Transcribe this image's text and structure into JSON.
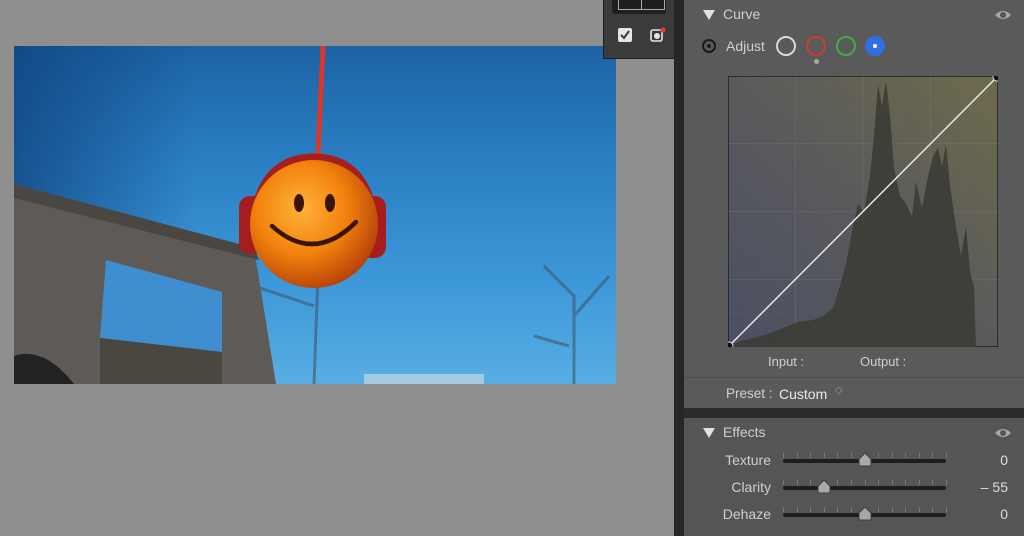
{
  "curve_panel": {
    "title": "Curve",
    "adjust_label": "Adjust",
    "channels": [
      {
        "name": "luminance",
        "color": "#d8d8d8",
        "selected": false
      },
      {
        "name": "red",
        "color": "#d03a34",
        "selected": false
      },
      {
        "name": "green",
        "color": "#3fae48",
        "selected": false
      },
      {
        "name": "blue",
        "color": "#2f6fe0",
        "selected": true
      }
    ],
    "input_label": "Input :",
    "output_label": "Output :",
    "preset_label": "Preset :",
    "preset_value": "Custom",
    "preset_chevron": "◇"
  },
  "effects_panel": {
    "title": "Effects",
    "sliders": [
      {
        "label": "Texture",
        "value": "0",
        "position": 0.5
      },
      {
        "label": "Clarity",
        "value": "– 55",
        "position": 0.25
      },
      {
        "label": "Dehaze",
        "value": "0",
        "position": 0.5
      }
    ]
  },
  "colors": {
    "panel_bg": "#555555",
    "curve_section_bg": "#5a5a5a",
    "canvas_bg": "#8f8f8f",
    "sky": "#2a7fc3",
    "smiley": "#f58a12"
  },
  "icons": [
    "eye-icon",
    "target-adjust-icon",
    "checkbox-icon",
    "mask-icon",
    "disclosure-triangle-icon"
  ]
}
